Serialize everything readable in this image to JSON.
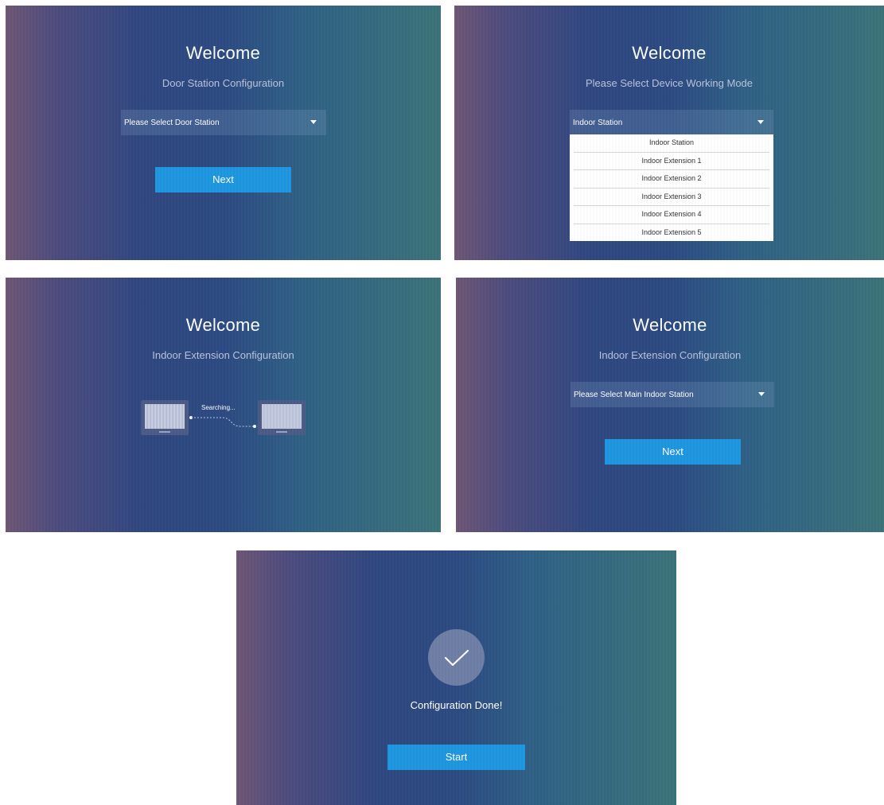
{
  "screens": [
    {
      "title": "Welcome",
      "subtitle": "Door Station Configuration",
      "dropdown": "Please Select Door Station",
      "button": "Next"
    },
    {
      "title": "Welcome",
      "subtitle": "Please Select Device Working Mode",
      "dropdown": "Indoor Station",
      "options": [
        "Indoor Station",
        "Indoor Extension 1",
        "Indoor Extension 2",
        "Indoor Extension 3",
        "Indoor Extension 4",
        "Indoor Extension 5"
      ]
    },
    {
      "title": "Welcome",
      "subtitle": "Indoor Extension Configuration",
      "status": "Searching..."
    },
    {
      "title": "Welcome",
      "subtitle": "Indoor Extension Configuration",
      "dropdown": "Please Select Main Indoor Station",
      "button": "Next"
    },
    {
      "message": "Configuration Done!",
      "button": "Start",
      "icon": "checkmark-icon"
    }
  ],
  "colors": {
    "accent": "#1e96e0",
    "gradient_left": "#6e5675",
    "gradient_mid": "#2c4a82",
    "gradient_right": "#3b7379"
  }
}
